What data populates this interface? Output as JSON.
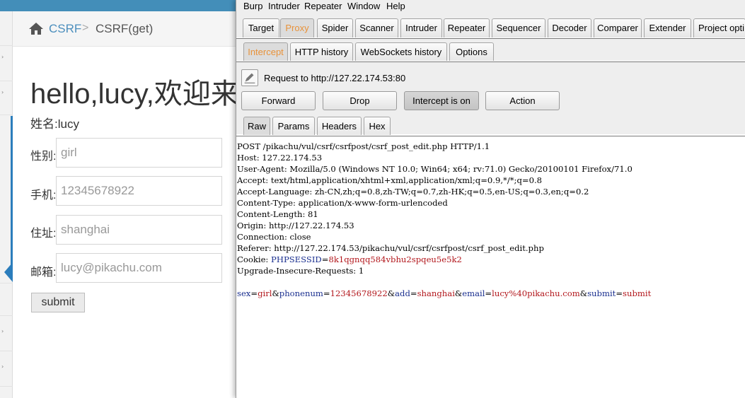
{
  "web": {
    "breadcrumb": {
      "home": "CSRF",
      "separator": ">",
      "current": "CSRF(get)"
    },
    "greeting": "hello,lucy,欢迎来",
    "name_line": "姓名:lucy",
    "form": [
      {
        "label": "性别:",
        "value": "girl"
      },
      {
        "label": "手机:",
        "value": "12345678922"
      },
      {
        "label": "住址:",
        "value": "shanghai"
      },
      {
        "label": "邮箱:",
        "value": "lucy@pikachu.com"
      }
    ],
    "submit_label": "submit"
  },
  "burp": {
    "menu": [
      "Burp",
      "Intruder",
      "Repeater",
      "Window",
      "Help"
    ],
    "main_tabs": [
      "Target",
      "Proxy",
      "Spider",
      "Scanner",
      "Intruder",
      "Repeater",
      "Sequencer",
      "Decoder",
      "Comparer",
      "Extender",
      "Project opti"
    ],
    "proxy_tabs": [
      "Intercept",
      "HTTP history",
      "WebSockets history",
      "Options"
    ],
    "request_to": "Request to http://127.22.174.53:80",
    "buttons": {
      "forward": "Forward",
      "drop": "Drop",
      "intercept": "Intercept is on",
      "action": "Action"
    },
    "view_tabs": [
      "Raw",
      "Params",
      "Headers",
      "Hex"
    ],
    "accent_color": "#e8923a",
    "request_lines": [
      "POST /pikachu/vul/csrf/csrfpost/csrf_post_edit.php HTTP/1.1",
      "Host: 127.22.174.53",
      "User-Agent: Mozilla/5.0 (Windows NT 10.0; Win64; x64; rv:71.0) Gecko/20100101 Firefox/71.0",
      "Accept: text/html,application/xhtml+xml,application/xml;q=0.9,*/*;q=0.8",
      "Accept-Language: zh-CN,zh;q=0.8,zh-TW;q=0.7,zh-HK;q=0.5,en-US;q=0.3,en;q=0.2",
      "Content-Type: application/x-www-form-urlencoded",
      "Content-Length: 81",
      "Origin: http://127.22.174.53",
      "Connection: close",
      "Referer: http://127.22.174.53/pikachu/vul/csrf/csrfpost/csrf_post_edit.php"
    ],
    "cookie": {
      "prefix": "Cookie: ",
      "name": "PHPSESSID",
      "eq": "=",
      "value": "8k1qgnqq584vbhu2spqeu5e5k2"
    },
    "upgrade_line": "Upgrade-Insecure-Requests: 1",
    "body_params": [
      {
        "key": "sex",
        "value": "girl",
        "sep": "&"
      },
      {
        "key": "phonenum",
        "value": "12345678922",
        "sep": "&"
      },
      {
        "key": "add",
        "value": "shanghai",
        "sep": "&"
      },
      {
        "key": "email",
        "value": "lucy%40pikachu.com",
        "sep": "&"
      },
      {
        "key": "submit",
        "value": "submit",
        "sep": ""
      }
    ]
  }
}
